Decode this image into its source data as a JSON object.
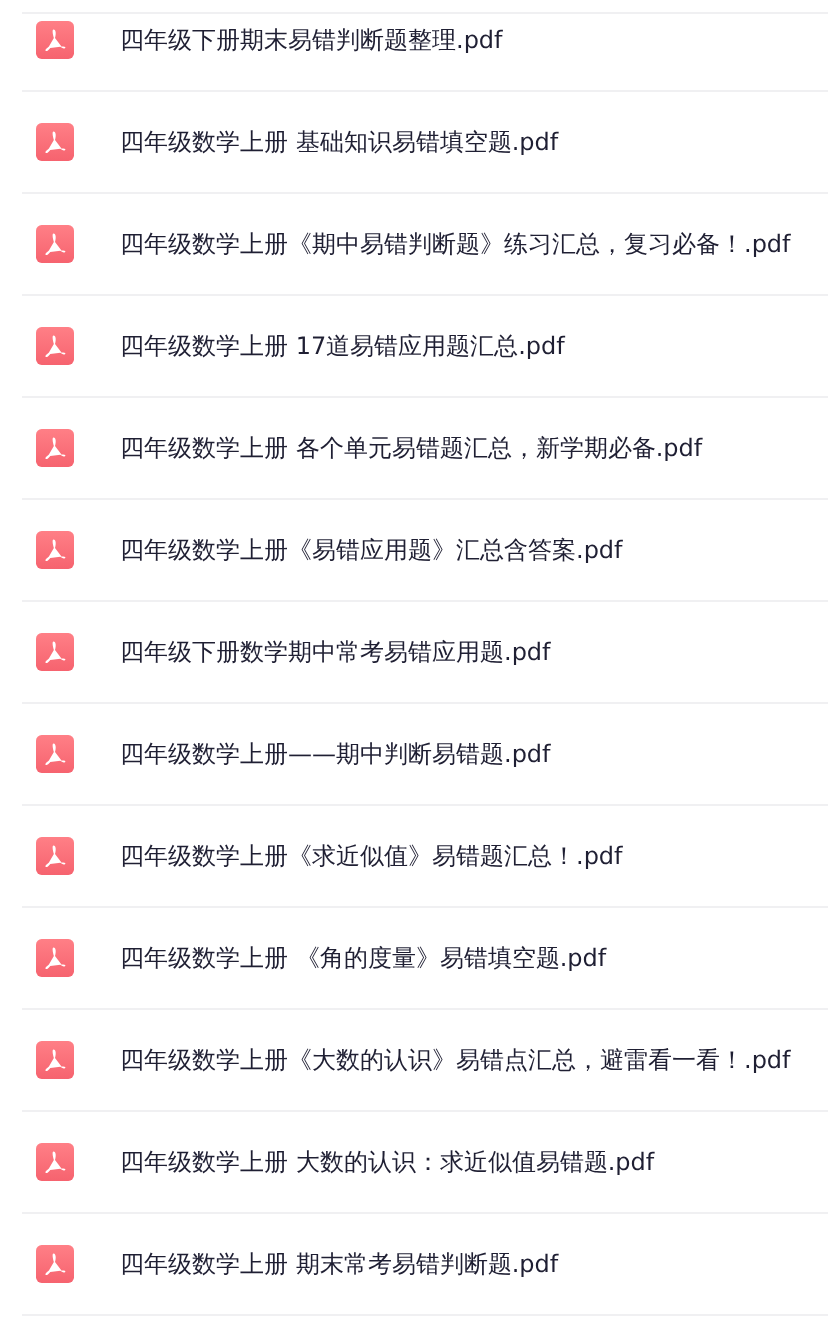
{
  "files": [
    {
      "name": "四年级下册期末易错判断题整理.pdf"
    },
    {
      "name": "四年级数学上册 基础知识易错填空题.pdf"
    },
    {
      "name": "四年级数学上册《期中易错判断题》练习汇总，复习必备！.pdf"
    },
    {
      "name": "四年级数学上册 17道易错应用题汇总.pdf"
    },
    {
      "name": "四年级数学上册 各个单元易错题汇总，新学期必备.pdf"
    },
    {
      "name": "四年级数学上册《易错应用题》汇总含答案.pdf"
    },
    {
      "name": "四年级下册数学期中常考易错应用题.pdf"
    },
    {
      "name": "四年级数学上册——期中判断易错题.pdf"
    },
    {
      "name": "四年级数学上册《求近似值》易错题汇总！.pdf"
    },
    {
      "name": "四年级数学上册 《角的度量》易错填空题.pdf"
    },
    {
      "name": "四年级数学上册《大数的认识》易错点汇总，避雷看一看！.pdf"
    },
    {
      "name": "四年级数学上册 大数的认识：求近似值易错题.pdf"
    },
    {
      "name": "四年级数学上册 期末常考易错判断题.pdf"
    }
  ]
}
